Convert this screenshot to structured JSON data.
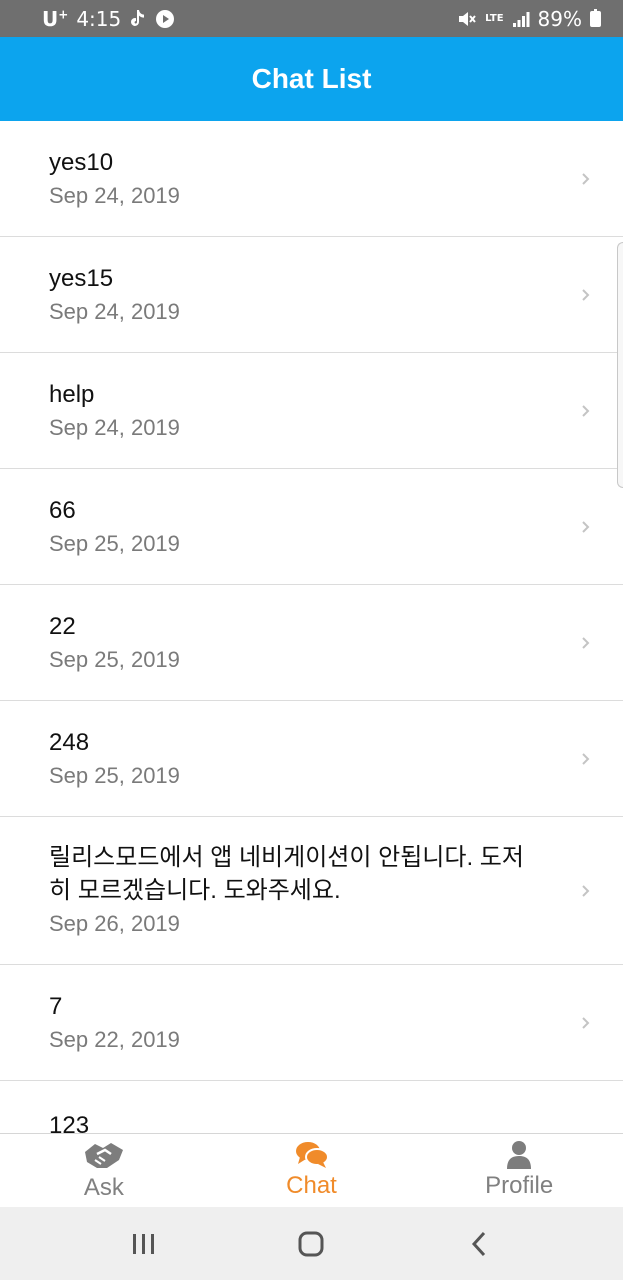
{
  "status_bar": {
    "carrier": "U",
    "carrier_sup": "+",
    "time": "4:15",
    "network": "LTE",
    "battery": "89%"
  },
  "header": {
    "title": "Chat List",
    "background_color": "#0ca4ee"
  },
  "chats": [
    {
      "title": "yes10",
      "date": "Sep 24, 2019"
    },
    {
      "title": "yes15",
      "date": "Sep 24, 2019"
    },
    {
      "title": "help",
      "date": "Sep 24, 2019"
    },
    {
      "title": "66",
      "date": "Sep 25, 2019"
    },
    {
      "title": "22",
      "date": "Sep 25, 2019"
    },
    {
      "title": "248",
      "date": "Sep 25, 2019"
    },
    {
      "title": "릴리스모드에서 앱 네비게이션이 안됩니다. 도저히 모르겠습니다. 도와주세요.",
      "date": "Sep 26, 2019"
    },
    {
      "title": "7",
      "date": "Sep 22, 2019"
    },
    {
      "title": "123",
      "date": ""
    }
  ],
  "tabs": [
    {
      "label": "Ask",
      "icon": "handshake-icon"
    },
    {
      "label": "Chat",
      "icon": "chat-bubbles-icon",
      "active": true,
      "active_color": "#f08b2a"
    },
    {
      "label": "Profile",
      "icon": "user-icon"
    }
  ],
  "system_nav": {
    "recents": "recent-apps-icon",
    "home": "home-icon",
    "back": "back-icon"
  }
}
